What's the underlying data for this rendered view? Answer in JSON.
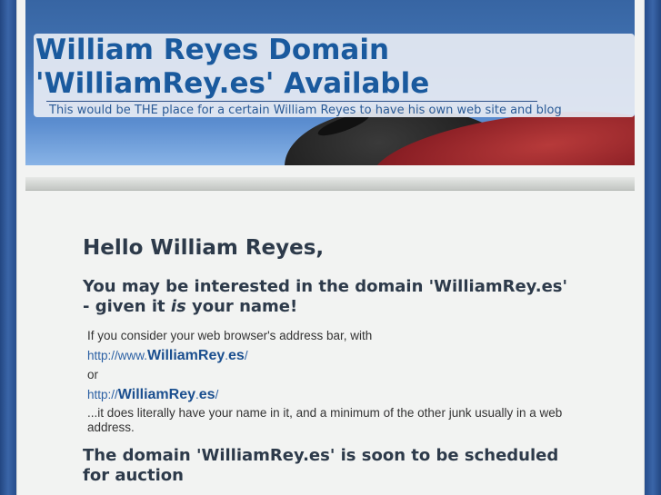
{
  "header": {
    "title_line1": "William Reyes Domain",
    "title_line2": "'WilliamRey.es' Available",
    "tagline": "This would be THE place for a certain William Reyes to have his own web site and blog"
  },
  "content": {
    "greeting": "Hello William Reyes,",
    "sub_heading_pre": "You may be interested in the domain 'WilliamRey.es' - given it ",
    "sub_heading_em": "is",
    "sub_heading_post": " your name!",
    "intro": "If you consider your web browser's address bar, with",
    "link1": {
      "prefix": "http://www.",
      "name": "WilliamRey",
      "dot": ".",
      "tld": "es",
      "suffix": "/"
    },
    "or_text": "or",
    "link2": {
      "prefix": "http://",
      "name": "WilliamRey",
      "dot": ".",
      "tld": "es",
      "suffix": "/"
    },
    "explanation": "...it does literally have your name in it, and a minimum of the other junk usually in a web address.",
    "auction_heading": "The domain 'WilliamRey.es' is soon to be scheduled for auction"
  }
}
